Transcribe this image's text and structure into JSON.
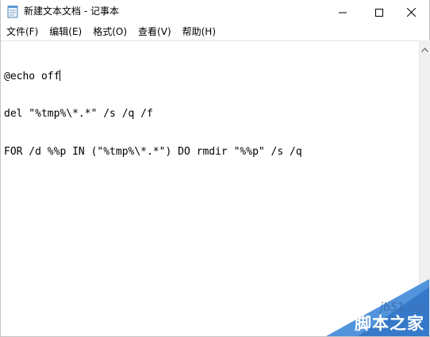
{
  "window": {
    "title": "新建文本文档 - 记事本"
  },
  "menu": {
    "items": [
      {
        "label": "文件(F)"
      },
      {
        "label": "编辑(E)"
      },
      {
        "label": "格式(O)"
      },
      {
        "label": "查看(V)"
      },
      {
        "label": "帮助(H)"
      }
    ]
  },
  "editor": {
    "lines": [
      "@echo off",
      "del \"%tmp%\\*.*\" /s /q /f",
      "FOR /d %%p IN (\"%tmp%\\*.*\") DO rmdir \"%%p\" /s /q"
    ]
  },
  "icons": {
    "app": "notepad-icon",
    "minimize": "minimize-icon",
    "maximize": "maximize-icon",
    "close": "close-icon",
    "scroll_up": "chevron-up-icon"
  },
  "watermark": {
    "url": "jb51.net",
    "brand": "脚本之家"
  },
  "colors": {
    "watermark_blue": "#3f88d8",
    "scrollbar": "#f0f0f0"
  }
}
